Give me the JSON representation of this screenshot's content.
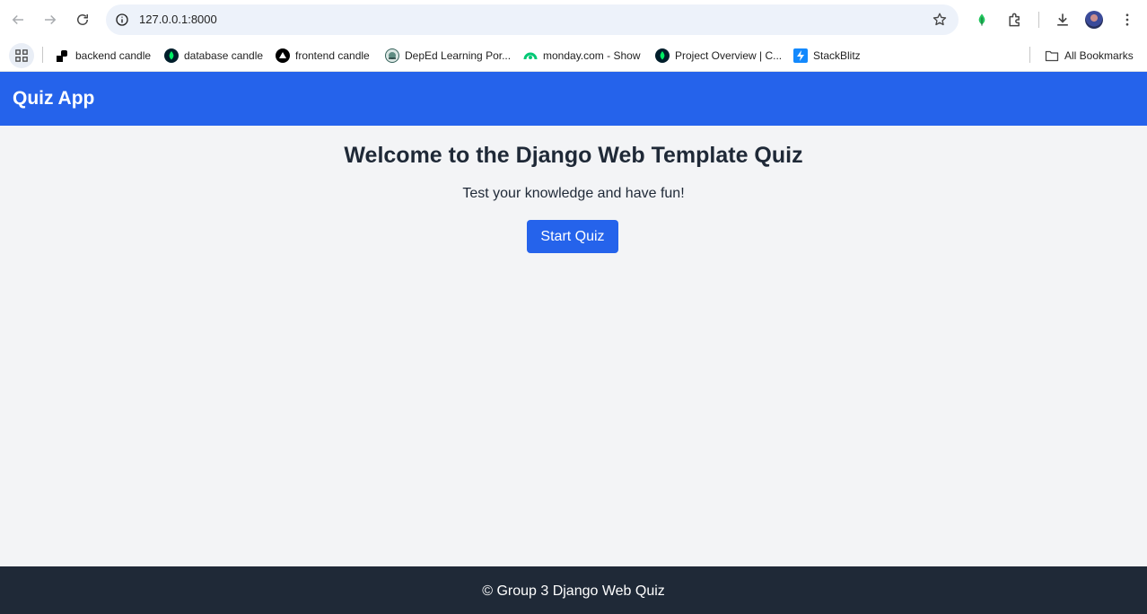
{
  "browser": {
    "url": "127.0.0.1:8000",
    "colors": {
      "omnibox_bg": "#edf2fa"
    }
  },
  "bookmarks": {
    "items": [
      {
        "label": "backend candle",
        "icon": "candle-logo-icon"
      },
      {
        "label": "database candle",
        "icon": "mongodb-leaf-icon"
      },
      {
        "label": "frontend candle",
        "icon": "triangle-logo-icon"
      },
      {
        "label": "DepEd Learning Por...",
        "icon": "deped-seal-icon"
      },
      {
        "label": "monday.com - Show",
        "icon": "monday-logo-icon"
      },
      {
        "label": "Project Overview | C...",
        "icon": "mongodb-leaf-icon"
      },
      {
        "label": "StackBlitz",
        "icon": "stackblitz-bolt-icon"
      }
    ],
    "all_bookmarks_label": "All Bookmarks"
  },
  "app": {
    "title": "Quiz App",
    "welcome_heading": "Welcome to the Django Web Template Quiz",
    "tagline": "Test your knowledge and have fun!",
    "start_button": "Start Quiz",
    "footer": "© Group 3 Django Web Quiz",
    "colors": {
      "primary": "#2563eb",
      "background": "#f3f4f6",
      "footer": "#1f2937",
      "text": "#1f2937"
    }
  }
}
